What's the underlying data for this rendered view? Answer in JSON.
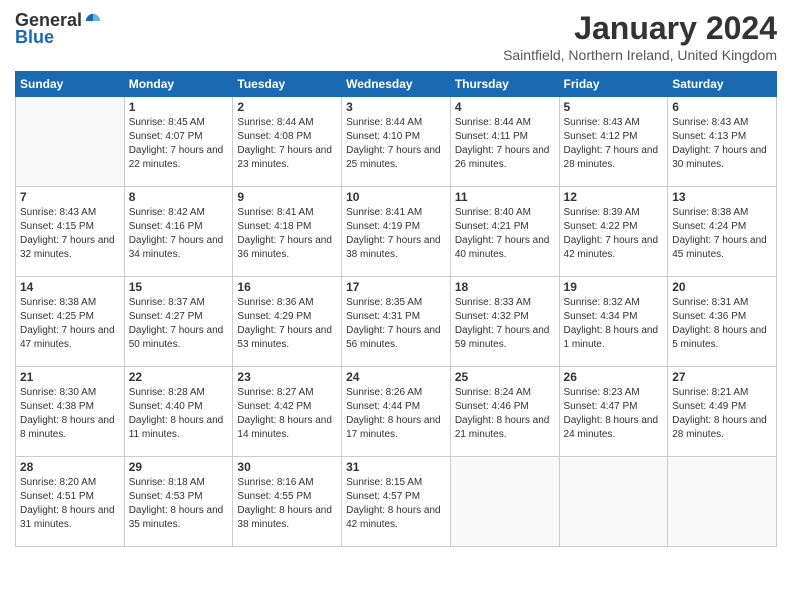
{
  "logo": {
    "general": "General",
    "blue": "Blue"
  },
  "title": "January 2024",
  "location": "Saintfield, Northern Ireland, United Kingdom",
  "days_of_week": [
    "Sunday",
    "Monday",
    "Tuesday",
    "Wednesday",
    "Thursday",
    "Friday",
    "Saturday"
  ],
  "weeks": [
    [
      {
        "day": "",
        "sunrise": "",
        "sunset": "",
        "daylight": ""
      },
      {
        "day": "1",
        "sunrise": "Sunrise: 8:45 AM",
        "sunset": "Sunset: 4:07 PM",
        "daylight": "Daylight: 7 hours and 22 minutes."
      },
      {
        "day": "2",
        "sunrise": "Sunrise: 8:44 AM",
        "sunset": "Sunset: 4:08 PM",
        "daylight": "Daylight: 7 hours and 23 minutes."
      },
      {
        "day": "3",
        "sunrise": "Sunrise: 8:44 AM",
        "sunset": "Sunset: 4:10 PM",
        "daylight": "Daylight: 7 hours and 25 minutes."
      },
      {
        "day": "4",
        "sunrise": "Sunrise: 8:44 AM",
        "sunset": "Sunset: 4:11 PM",
        "daylight": "Daylight: 7 hours and 26 minutes."
      },
      {
        "day": "5",
        "sunrise": "Sunrise: 8:43 AM",
        "sunset": "Sunset: 4:12 PM",
        "daylight": "Daylight: 7 hours and 28 minutes."
      },
      {
        "day": "6",
        "sunrise": "Sunrise: 8:43 AM",
        "sunset": "Sunset: 4:13 PM",
        "daylight": "Daylight: 7 hours and 30 minutes."
      }
    ],
    [
      {
        "day": "7",
        "sunrise": "Sunrise: 8:43 AM",
        "sunset": "Sunset: 4:15 PM",
        "daylight": "Daylight: 7 hours and 32 minutes."
      },
      {
        "day": "8",
        "sunrise": "Sunrise: 8:42 AM",
        "sunset": "Sunset: 4:16 PM",
        "daylight": "Daylight: 7 hours and 34 minutes."
      },
      {
        "day": "9",
        "sunrise": "Sunrise: 8:41 AM",
        "sunset": "Sunset: 4:18 PM",
        "daylight": "Daylight: 7 hours and 36 minutes."
      },
      {
        "day": "10",
        "sunrise": "Sunrise: 8:41 AM",
        "sunset": "Sunset: 4:19 PM",
        "daylight": "Daylight: 7 hours and 38 minutes."
      },
      {
        "day": "11",
        "sunrise": "Sunrise: 8:40 AM",
        "sunset": "Sunset: 4:21 PM",
        "daylight": "Daylight: 7 hours and 40 minutes."
      },
      {
        "day": "12",
        "sunrise": "Sunrise: 8:39 AM",
        "sunset": "Sunset: 4:22 PM",
        "daylight": "Daylight: 7 hours and 42 minutes."
      },
      {
        "day": "13",
        "sunrise": "Sunrise: 8:38 AM",
        "sunset": "Sunset: 4:24 PM",
        "daylight": "Daylight: 7 hours and 45 minutes."
      }
    ],
    [
      {
        "day": "14",
        "sunrise": "Sunrise: 8:38 AM",
        "sunset": "Sunset: 4:25 PM",
        "daylight": "Daylight: 7 hours and 47 minutes."
      },
      {
        "day": "15",
        "sunrise": "Sunrise: 8:37 AM",
        "sunset": "Sunset: 4:27 PM",
        "daylight": "Daylight: 7 hours and 50 minutes."
      },
      {
        "day": "16",
        "sunrise": "Sunrise: 8:36 AM",
        "sunset": "Sunset: 4:29 PM",
        "daylight": "Daylight: 7 hours and 53 minutes."
      },
      {
        "day": "17",
        "sunrise": "Sunrise: 8:35 AM",
        "sunset": "Sunset: 4:31 PM",
        "daylight": "Daylight: 7 hours and 56 minutes."
      },
      {
        "day": "18",
        "sunrise": "Sunrise: 8:33 AM",
        "sunset": "Sunset: 4:32 PM",
        "daylight": "Daylight: 7 hours and 59 minutes."
      },
      {
        "day": "19",
        "sunrise": "Sunrise: 8:32 AM",
        "sunset": "Sunset: 4:34 PM",
        "daylight": "Daylight: 8 hours and 1 minute."
      },
      {
        "day": "20",
        "sunrise": "Sunrise: 8:31 AM",
        "sunset": "Sunset: 4:36 PM",
        "daylight": "Daylight: 8 hours and 5 minutes."
      }
    ],
    [
      {
        "day": "21",
        "sunrise": "Sunrise: 8:30 AM",
        "sunset": "Sunset: 4:38 PM",
        "daylight": "Daylight: 8 hours and 8 minutes."
      },
      {
        "day": "22",
        "sunrise": "Sunrise: 8:28 AM",
        "sunset": "Sunset: 4:40 PM",
        "daylight": "Daylight: 8 hours and 11 minutes."
      },
      {
        "day": "23",
        "sunrise": "Sunrise: 8:27 AM",
        "sunset": "Sunset: 4:42 PM",
        "daylight": "Daylight: 8 hours and 14 minutes."
      },
      {
        "day": "24",
        "sunrise": "Sunrise: 8:26 AM",
        "sunset": "Sunset: 4:44 PM",
        "daylight": "Daylight: 8 hours and 17 minutes."
      },
      {
        "day": "25",
        "sunrise": "Sunrise: 8:24 AM",
        "sunset": "Sunset: 4:46 PM",
        "daylight": "Daylight: 8 hours and 21 minutes."
      },
      {
        "day": "26",
        "sunrise": "Sunrise: 8:23 AM",
        "sunset": "Sunset: 4:47 PM",
        "daylight": "Daylight: 8 hours and 24 minutes."
      },
      {
        "day": "27",
        "sunrise": "Sunrise: 8:21 AM",
        "sunset": "Sunset: 4:49 PM",
        "daylight": "Daylight: 8 hours and 28 minutes."
      }
    ],
    [
      {
        "day": "28",
        "sunrise": "Sunrise: 8:20 AM",
        "sunset": "Sunset: 4:51 PM",
        "daylight": "Daylight: 8 hours and 31 minutes."
      },
      {
        "day": "29",
        "sunrise": "Sunrise: 8:18 AM",
        "sunset": "Sunset: 4:53 PM",
        "daylight": "Daylight: 8 hours and 35 minutes."
      },
      {
        "day": "30",
        "sunrise": "Sunrise: 8:16 AM",
        "sunset": "Sunset: 4:55 PM",
        "daylight": "Daylight: 8 hours and 38 minutes."
      },
      {
        "day": "31",
        "sunrise": "Sunrise: 8:15 AM",
        "sunset": "Sunset: 4:57 PM",
        "daylight": "Daylight: 8 hours and 42 minutes."
      },
      {
        "day": "",
        "sunrise": "",
        "sunset": "",
        "daylight": ""
      },
      {
        "day": "",
        "sunrise": "",
        "sunset": "",
        "daylight": ""
      },
      {
        "day": "",
        "sunrise": "",
        "sunset": "",
        "daylight": ""
      }
    ]
  ]
}
